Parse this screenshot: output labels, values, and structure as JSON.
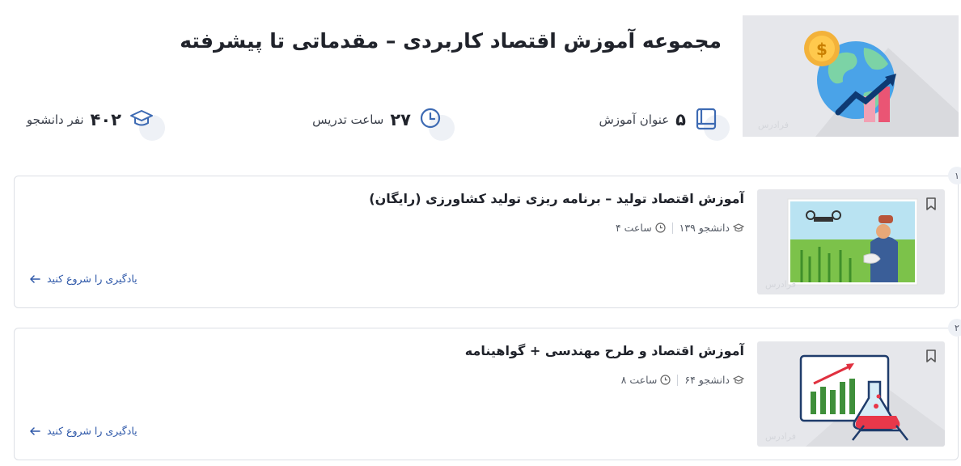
{
  "header": {
    "title": "مجموعه آموزش اقتصاد کاربردی – مقدماتی تا پیشرفته",
    "image_watermark": "فرادرس"
  },
  "stats": {
    "courses": {
      "value": "۵",
      "label": "عنوان آموزش",
      "icon": "book-icon"
    },
    "hours": {
      "value": "۲۷",
      "label": "ساعت تدریس",
      "icon": "clock-icon"
    },
    "students": {
      "value": "۴۰۲",
      "label": "نفر دانشجو",
      "icon": "graduation-cap-icon"
    }
  },
  "courses": [
    {
      "index": "۱",
      "title": "آموزش اقتصاد تولید – برنامه ریزی تولید کشاورزی (رایگان)",
      "students": "۱۳۹ دانشجو",
      "hours": "۴ ساعت",
      "cta": "یادگیری را شروع کنید"
    },
    {
      "index": "۲",
      "title": "آموزش اقتصاد و طرح مهندسی + گواهینامه",
      "students": "۶۴ دانشجو",
      "hours": "۸ ساعت",
      "cta": "یادگیری را شروع کنید"
    }
  ],
  "colors": {
    "accent": "#2d57a8",
    "icon_blue": "#3d6ab3",
    "border": "#dcdfe5"
  }
}
